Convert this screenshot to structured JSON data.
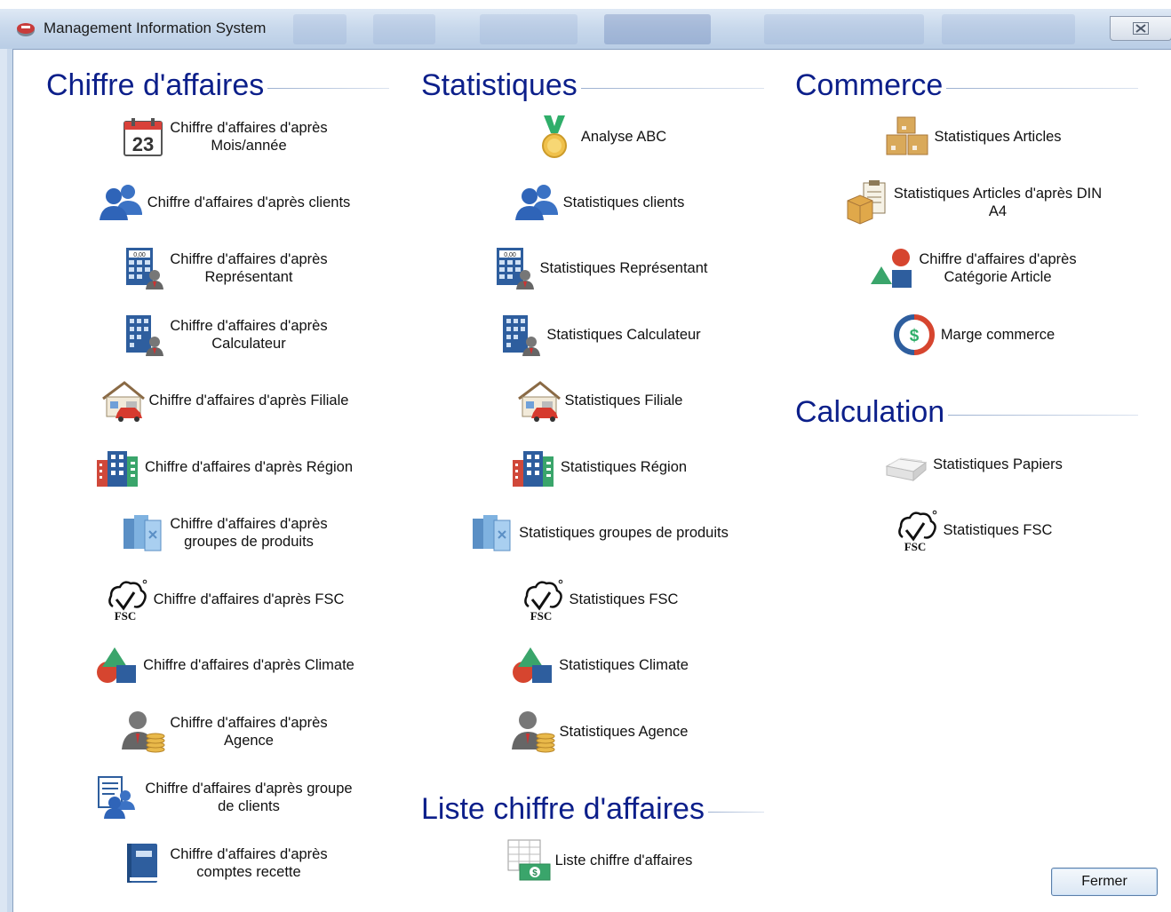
{
  "window": {
    "title": "Management Information System",
    "close_symbol": "☒"
  },
  "sections": {
    "chiffre": {
      "title": "Chiffre d'affaires",
      "items": [
        {
          "label": "Chiffre d'affaires d'après\nMois/année",
          "icon": "calendar-icon"
        },
        {
          "label": "Chiffre d'affaires d'après clients",
          "icon": "users-icon"
        },
        {
          "label": "Chiffre d'affaires d'après\nReprésentant",
          "icon": "calculator-person-icon"
        },
        {
          "label": "Chiffre d'affaires d'après\nCalculateur",
          "icon": "building-person-icon"
        },
        {
          "label": "Chiffre d'affaires d'après Filiale",
          "icon": "house-car-icon"
        },
        {
          "label": "Chiffre d'affaires d'après Région",
          "icon": "city-icon"
        },
        {
          "label": "Chiffre d'affaires d'après\ngroupes de produits",
          "icon": "product-boxes-icon"
        },
        {
          "label": "Chiffre d'affaires d'après FSC",
          "icon": "fsc-icon"
        },
        {
          "label": "Chiffre d'affaires d'après Climate",
          "icon": "shapes-icon"
        },
        {
          "label": "Chiffre d'affaires d'après\nAgence",
          "icon": "person-coins-icon"
        },
        {
          "label": "Chiffre d'affaires d'après groupe\nde clients",
          "icon": "group-list-icon"
        },
        {
          "label": "Chiffre d'affaires d'après\ncomptes recette",
          "icon": "book-icon"
        }
      ]
    },
    "statistiques": {
      "title": "Statistiques",
      "items": [
        {
          "label": "Analyse ABC",
          "icon": "medal-icon"
        },
        {
          "label": "Statistiques clients",
          "icon": "users-icon"
        },
        {
          "label": "Statistiques Représentant",
          "icon": "calculator-person-icon"
        },
        {
          "label": "Statistiques Calculateur",
          "icon": "building-person-icon"
        },
        {
          "label": "Statistiques Filiale",
          "icon": "house-car-icon"
        },
        {
          "label": "Statistiques Région",
          "icon": "city-icon"
        },
        {
          "label": "Statistiques groupes de produits",
          "icon": "product-boxes-icon"
        },
        {
          "label": "Statistiques FSC",
          "icon": "fsc-icon"
        },
        {
          "label": "Statistiques Climate",
          "icon": "shapes-icon"
        },
        {
          "label": "Statistiques Agence",
          "icon": "person-coins-icon"
        }
      ]
    },
    "liste": {
      "title": "Liste chiffre d'affaires",
      "items": [
        {
          "label": "Liste chiffre d'affaires",
          "icon": "money-grid-icon"
        }
      ]
    },
    "commerce": {
      "title": "Commerce",
      "items": [
        {
          "label": "Statistiques Articles",
          "icon": "boxes-icon"
        },
        {
          "label": "Statistiques Articles d'après DIN\nA4",
          "icon": "box-clipboard-icon"
        },
        {
          "label": "Chiffre d'affaires d'après\nCatégorie Article",
          "icon": "category-shapes-icon"
        },
        {
          "label": "Marge commerce",
          "icon": "dollar-cycle-icon"
        }
      ]
    },
    "calculation": {
      "title": "Calculation",
      "items": [
        {
          "label": "Statistiques Papiers",
          "icon": "paper-stack-icon"
        },
        {
          "label": "Statistiques FSC",
          "icon": "fsc-icon"
        }
      ]
    }
  },
  "buttons": {
    "close": "Fermer"
  },
  "fsc_text": "FSC",
  "calendar_day": "23",
  "money_symbol": "$"
}
